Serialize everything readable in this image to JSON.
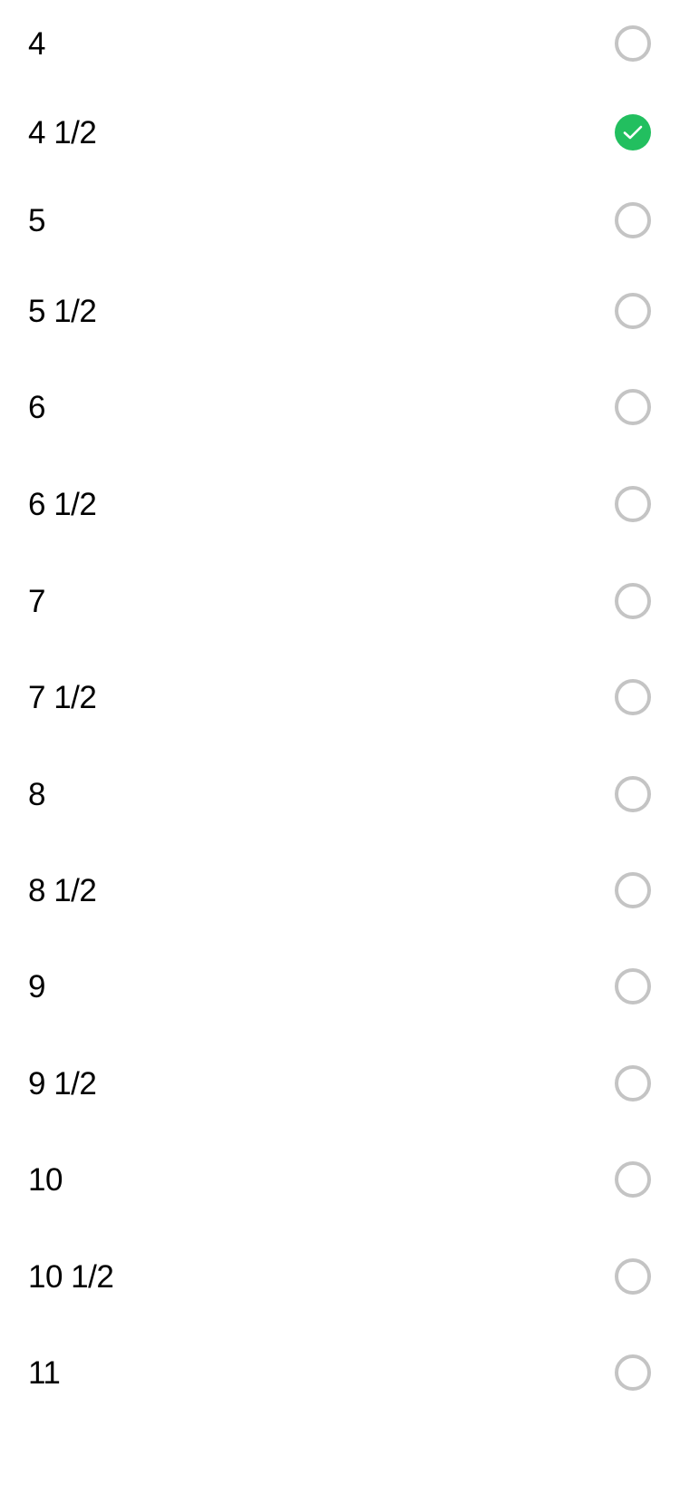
{
  "size_options": [
    {
      "label": "4",
      "selected": false
    },
    {
      "label": "4 1/2",
      "selected": true
    },
    {
      "label": "5",
      "selected": false
    },
    {
      "label": "5 1/2",
      "selected": false
    },
    {
      "label": "6",
      "selected": false
    },
    {
      "label": "6 1/2",
      "selected": false
    },
    {
      "label": "7",
      "selected": false
    },
    {
      "label": "7 1/2",
      "selected": false
    },
    {
      "label": "8",
      "selected": false
    },
    {
      "label": "8 1/2",
      "selected": false
    },
    {
      "label": "9",
      "selected": false
    },
    {
      "label": "9 1/2",
      "selected": false
    },
    {
      "label": "10",
      "selected": false
    },
    {
      "label": "10 1/2",
      "selected": false
    },
    {
      "label": "11",
      "selected": false
    }
  ],
  "colors": {
    "selected_accent": "#22bf5f",
    "unselected_ring": "#c4c4c4",
    "text": "#000000",
    "background": "#ffffff"
  },
  "icons": {
    "selected": "checkmark-circle-icon",
    "unselected": "radio-empty-icon"
  }
}
